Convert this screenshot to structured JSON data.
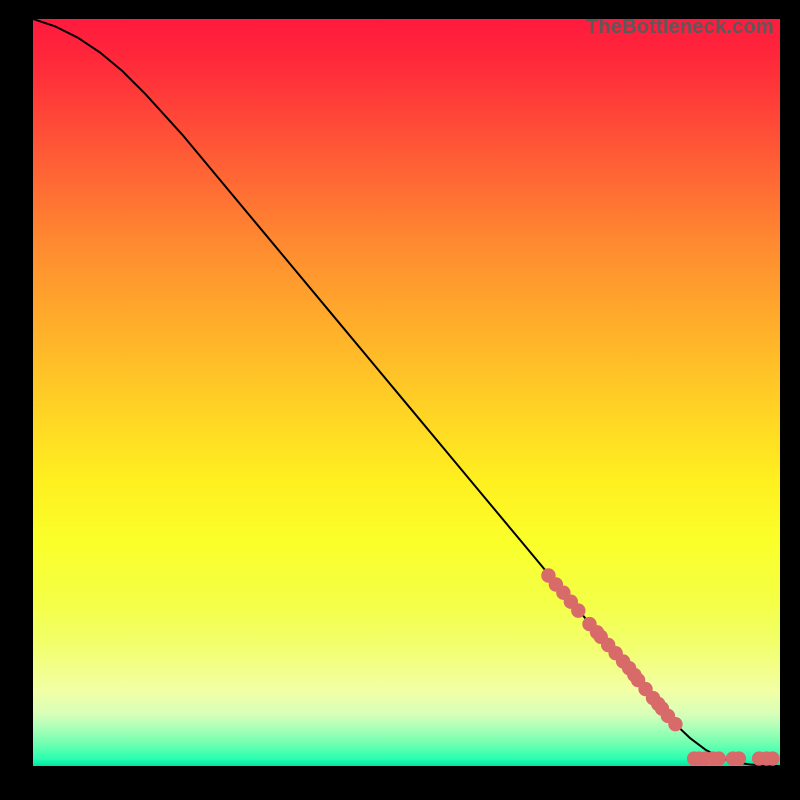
{
  "watermark": "TheBottleneck.com",
  "chart_data": {
    "type": "line",
    "title": "",
    "xlabel": "",
    "ylabel": "",
    "xlim": [
      0,
      100
    ],
    "ylim": [
      0,
      100
    ],
    "grid": false,
    "legend": false,
    "series": [
      {
        "name": "curve",
        "color": "#000000",
        "x": [
          0,
          3,
          6,
          9,
          12,
          15,
          20,
          25,
          30,
          35,
          40,
          45,
          50,
          55,
          60,
          65,
          70,
          75,
          80,
          82,
          84,
          86,
          88,
          90,
          92,
          94,
          96,
          98,
          100
        ],
        "y": [
          100,
          99,
          97.5,
          95.5,
          93,
          90,
          84.5,
          78.5,
          72.5,
          66.5,
          60.5,
          54.5,
          48.5,
          42.5,
          36.5,
          30.5,
          24.5,
          18.5,
          12.5,
          10,
          7.8,
          5.6,
          3.7,
          2.2,
          1.1,
          0.5,
          0.2,
          0.05,
          0
        ]
      },
      {
        "name": "markers",
        "color": "#d86a6a",
        "type": "scatter",
        "points": [
          {
            "x": 69,
            "y": 25.5
          },
          {
            "x": 70,
            "y": 24.3
          },
          {
            "x": 71,
            "y": 23.2
          },
          {
            "x": 72,
            "y": 22.0
          },
          {
            "x": 73,
            "y": 20.8
          },
          {
            "x": 74.5,
            "y": 19.0
          },
          {
            "x": 75.5,
            "y": 17.9
          },
          {
            "x": 76,
            "y": 17.3
          },
          {
            "x": 77,
            "y": 16.2
          },
          {
            "x": 78,
            "y": 15.1
          },
          {
            "x": 79,
            "y": 14.0
          },
          {
            "x": 79.8,
            "y": 13.1
          },
          {
            "x": 80.5,
            "y": 12.2
          },
          {
            "x": 81,
            "y": 11.5
          },
          {
            "x": 82,
            "y": 10.3
          },
          {
            "x": 83,
            "y": 9.1
          },
          {
            "x": 83.7,
            "y": 8.3
          },
          {
            "x": 84.2,
            "y": 7.7
          },
          {
            "x": 85,
            "y": 6.7
          },
          {
            "x": 86,
            "y": 5.6
          },
          {
            "x": 88.5,
            "y": 1.0
          },
          {
            "x": 89.2,
            "y": 1.0
          },
          {
            "x": 90,
            "y": 1.0
          },
          {
            "x": 91,
            "y": 1.0
          },
          {
            "x": 91.8,
            "y": 1.0
          },
          {
            "x": 93.7,
            "y": 1.0
          },
          {
            "x": 94.5,
            "y": 1.0
          },
          {
            "x": 97.2,
            "y": 1.0
          },
          {
            "x": 98.2,
            "y": 1.0
          },
          {
            "x": 99,
            "y": 1.0
          }
        ]
      }
    ]
  }
}
